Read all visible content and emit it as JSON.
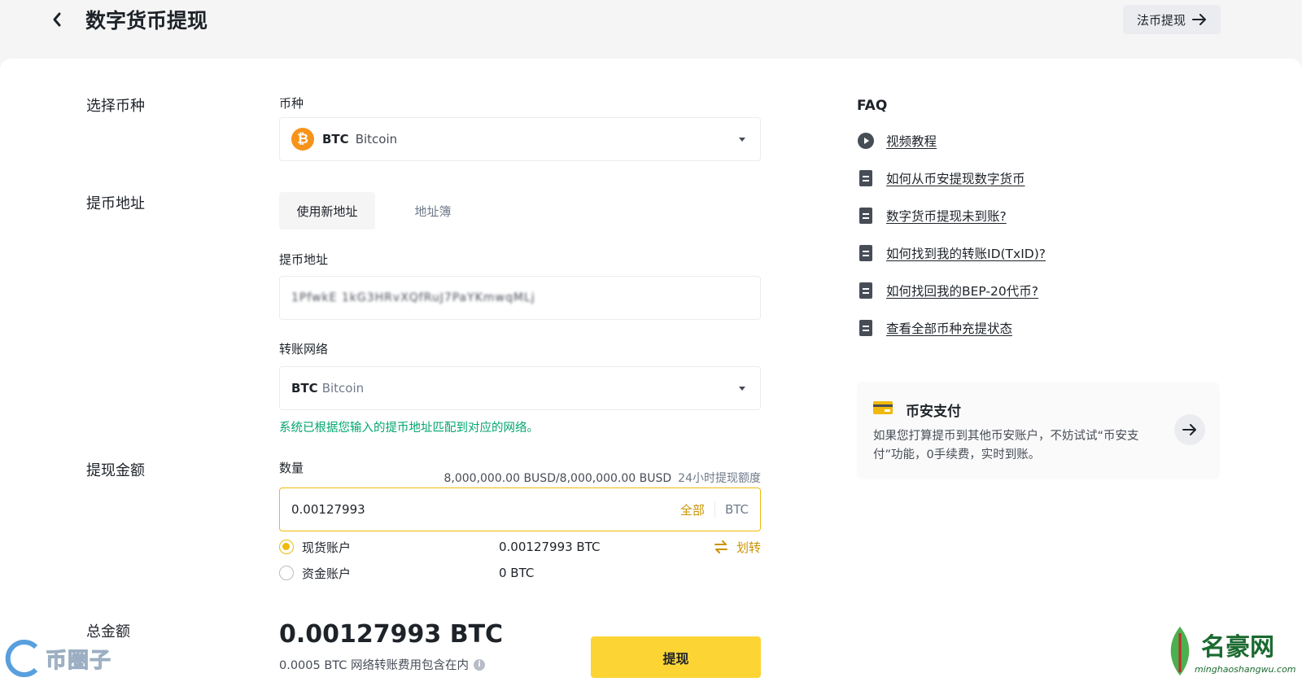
{
  "header": {
    "title": "数字货币提现",
    "fiat_button": "法币提现"
  },
  "sections": {
    "coin": "选择币种",
    "address": "提币地址",
    "amount": "提现金额",
    "total": "总金额"
  },
  "coin_select": {
    "label": "币种",
    "code": "BTC",
    "name": "Bitcoin",
    "logo": "₿"
  },
  "address_tabs": {
    "new": "使用新地址",
    "book": "地址簿"
  },
  "address_field": {
    "label": "提币地址",
    "value": "1PfwkE 1kG3HRvXQfRuJ7PaYKmwqMLj"
  },
  "network": {
    "label": "转账网络",
    "code": "BTC",
    "name": "Bitcoin",
    "hint": "系统已根据您输入的提币地址匹配到对应的网络。"
  },
  "amount": {
    "label": "数量",
    "limit": "8,000,000.00 BUSD/8,000,000.00 BUSD",
    "limit_note": "24小时提现额度",
    "value": "0.00127993",
    "max": "全部",
    "unit": "BTC"
  },
  "accounts": [
    {
      "label": "现货账户",
      "balance": "0.00127993 BTC",
      "checked": true
    },
    {
      "label": "资金账户",
      "balance": "0 BTC",
      "checked": false
    }
  ],
  "transfer": "划转",
  "total": {
    "amount": "0.00127993 BTC",
    "fee_note": "0.0005 BTC 网络转账费用包含在内",
    "withdraw": "提现"
  },
  "faq": {
    "title": "FAQ",
    "items": [
      {
        "icon": "play-circle-icon",
        "text": "视频教程"
      },
      {
        "icon": "document-icon",
        "text": "如何从币安提现数字货币"
      },
      {
        "icon": "document-icon",
        "text": "数字货币提现未到账?"
      },
      {
        "icon": "document-icon",
        "text": "如何找到我的转账ID(TxID)?"
      },
      {
        "icon": "document-icon",
        "text": "如何找回我的BEP-20代币?"
      },
      {
        "icon": "document-icon",
        "text": "查看全部币种充提状态"
      }
    ]
  },
  "pay_card": {
    "title": "币安支付",
    "desc": "如果您打算提币到其他币安账户，不妨试试“币安支付”功能，0手续费，实时到账。"
  },
  "watermarks": {
    "left": "币圈子",
    "right_brand": "名豪网",
    "right_url": "minghaoshangwu.com"
  },
  "colors": {
    "accent": "#f0b90b",
    "button": "#fcd535",
    "success": "#03a66d",
    "btc": "#f7931a"
  }
}
